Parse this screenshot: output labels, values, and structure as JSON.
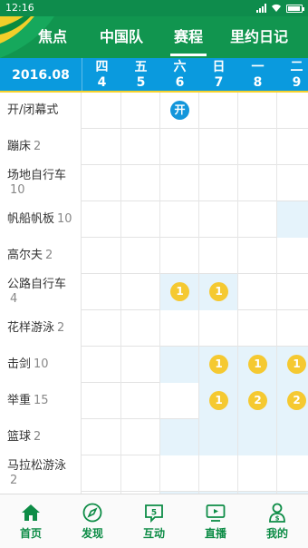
{
  "status_bar": {
    "time": "12:16"
  },
  "top_tabs": [
    {
      "label": "焦点",
      "active": false
    },
    {
      "label": "中国队",
      "active": false
    },
    {
      "label": "赛程",
      "active": true
    },
    {
      "label": "里约日记",
      "active": false
    }
  ],
  "date_header": {
    "month": "2016.08",
    "days": [
      {
        "weekday": "四",
        "date": "4"
      },
      {
        "weekday": "五",
        "date": "5"
      },
      {
        "weekday": "六",
        "date": "6"
      },
      {
        "weekday": "日",
        "date": "7"
      },
      {
        "weekday": "一",
        "date": "8"
      },
      {
        "weekday": "二",
        "date": "9"
      }
    ]
  },
  "schedule": [
    {
      "name": "开/闭幕式",
      "count": "",
      "cells": [
        {
          "bg": false,
          "badge": ""
        },
        {
          "bg": false,
          "badge": ""
        },
        {
          "bg": false,
          "badge": "开",
          "badge_color": "blue"
        },
        {
          "bg": false,
          "badge": ""
        },
        {
          "bg": false,
          "badge": ""
        },
        {
          "bg": false,
          "badge": ""
        }
      ]
    },
    {
      "name": "蹦床",
      "count": "2",
      "cells": [
        {
          "bg": false,
          "badge": ""
        },
        {
          "bg": false,
          "badge": ""
        },
        {
          "bg": false,
          "badge": ""
        },
        {
          "bg": false,
          "badge": ""
        },
        {
          "bg": false,
          "badge": ""
        },
        {
          "bg": false,
          "badge": ""
        }
      ]
    },
    {
      "name": "场地自行车",
      "count": "10",
      "cells": [
        {
          "bg": false,
          "badge": ""
        },
        {
          "bg": false,
          "badge": ""
        },
        {
          "bg": false,
          "badge": ""
        },
        {
          "bg": false,
          "badge": ""
        },
        {
          "bg": false,
          "badge": ""
        },
        {
          "bg": false,
          "badge": ""
        }
      ]
    },
    {
      "name": "帆船帆板",
      "count": "10",
      "cells": [
        {
          "bg": false,
          "badge": ""
        },
        {
          "bg": false,
          "badge": ""
        },
        {
          "bg": false,
          "badge": ""
        },
        {
          "bg": false,
          "badge": ""
        },
        {
          "bg": false,
          "badge": ""
        },
        {
          "bg": true,
          "badge": ""
        }
      ]
    },
    {
      "name": "高尔夫",
      "count": "2",
      "cells": [
        {
          "bg": false,
          "badge": ""
        },
        {
          "bg": false,
          "badge": ""
        },
        {
          "bg": false,
          "badge": ""
        },
        {
          "bg": false,
          "badge": ""
        },
        {
          "bg": false,
          "badge": ""
        },
        {
          "bg": false,
          "badge": ""
        }
      ]
    },
    {
      "name": "公路自行车",
      "count": "4",
      "cells": [
        {
          "bg": false,
          "badge": ""
        },
        {
          "bg": false,
          "badge": ""
        },
        {
          "bg": true,
          "badge": "1",
          "badge_color": "yellow"
        },
        {
          "bg": true,
          "badge": "1",
          "badge_color": "yellow"
        },
        {
          "bg": false,
          "badge": ""
        },
        {
          "bg": false,
          "badge": ""
        }
      ]
    },
    {
      "name": "花样游泳",
      "count": "2",
      "cells": [
        {
          "bg": false,
          "badge": ""
        },
        {
          "bg": false,
          "badge": ""
        },
        {
          "bg": false,
          "badge": ""
        },
        {
          "bg": false,
          "badge": ""
        },
        {
          "bg": false,
          "badge": ""
        },
        {
          "bg": false,
          "badge": ""
        }
      ]
    },
    {
      "name": "击剑",
      "count": "10",
      "cells": [
        {
          "bg": false,
          "badge": ""
        },
        {
          "bg": false,
          "badge": ""
        },
        {
          "bg": true,
          "badge": ""
        },
        {
          "bg": true,
          "badge": "1",
          "badge_color": "yellow"
        },
        {
          "bg": true,
          "badge": "1",
          "badge_color": "yellow"
        },
        {
          "bg": true,
          "badge": "1",
          "badge_color": "yellow"
        }
      ]
    },
    {
      "name": "举重",
      "count": "15",
      "cells": [
        {
          "bg": false,
          "badge": ""
        },
        {
          "bg": false,
          "badge": ""
        },
        {
          "bg": false,
          "badge": ""
        },
        {
          "bg": true,
          "badge": "1",
          "badge_color": "yellow"
        },
        {
          "bg": true,
          "badge": "2",
          "badge_color": "yellow"
        },
        {
          "bg": true,
          "badge": "2",
          "badge_color": "yellow"
        }
      ]
    },
    {
      "name": "篮球",
      "count": "2",
      "cells": [
        {
          "bg": false,
          "badge": ""
        },
        {
          "bg": false,
          "badge": ""
        },
        {
          "bg": true,
          "badge": ""
        },
        {
          "bg": true,
          "badge": ""
        },
        {
          "bg": true,
          "badge": ""
        },
        {
          "bg": true,
          "badge": ""
        }
      ]
    },
    {
      "name": "马拉松游泳",
      "count": "2",
      "cells": [
        {
          "bg": false,
          "badge": ""
        },
        {
          "bg": false,
          "badge": ""
        },
        {
          "bg": false,
          "badge": ""
        },
        {
          "bg": false,
          "badge": ""
        },
        {
          "bg": false,
          "badge": ""
        },
        {
          "bg": false,
          "badge": ""
        }
      ]
    },
    {
      "name": "",
      "count": "",
      "cells": [
        {
          "bg": false,
          "badge": ""
        },
        {
          "bg": false,
          "badge": ""
        },
        {
          "bg": true,
          "badge": ""
        },
        {
          "bg": true,
          "badge": ""
        },
        {
          "bg": true,
          "badge": ""
        },
        {
          "bg": true,
          "badge": ""
        }
      ]
    }
  ],
  "bottom_nav": [
    {
      "label": "首页",
      "icon": "home-icon"
    },
    {
      "label": "发现",
      "icon": "compass-icon"
    },
    {
      "label": "互动",
      "icon": "chat-icon"
    },
    {
      "label": "直播",
      "icon": "tv-icon"
    },
    {
      "label": "我的",
      "icon": "profile-icon"
    }
  ],
  "colors": {
    "header_green": "#11954f",
    "date_blue": "#0a9ade",
    "badge_yellow": "#f5c931",
    "badge_blue": "#1296db",
    "cell_highlight": "#e5f3fb",
    "nav_green": "#0d8c46"
  }
}
